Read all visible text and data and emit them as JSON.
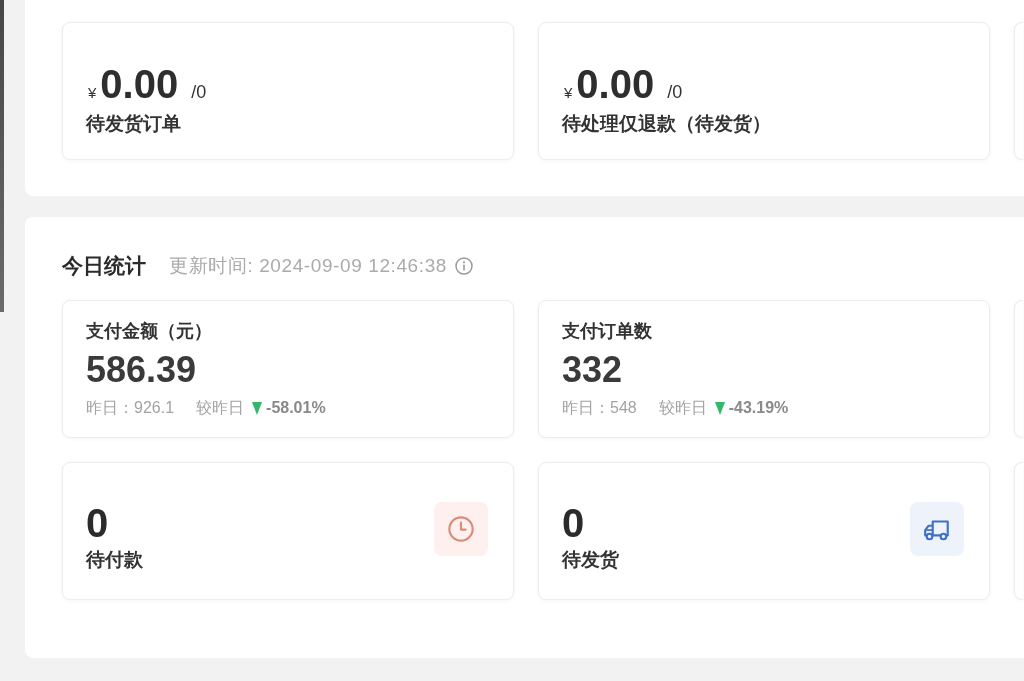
{
  "summary_cards": [
    {
      "currency": "¥",
      "amount": "0.00",
      "count": "/0",
      "label": "待发货订单"
    },
    {
      "currency": "¥",
      "amount": "0.00",
      "count": "/0",
      "label": "待处理仅退款（待发货）"
    }
  ],
  "today_stats": {
    "title": "今日统计",
    "updated": "更新时间: 2024-09-09 12:46:38",
    "metrics": [
      {
        "label": "支付金额（元）",
        "value": "586.39",
        "yesterday": "昨日：926.1",
        "compare_label": "较昨日",
        "declined": true,
        "change": "-58.01%"
      },
      {
        "label": "支付订单数",
        "value": "332",
        "yesterday": "昨日：548",
        "compare_label": "较昨日",
        "declined": true,
        "change": "-43.19%"
      }
    ],
    "counters": [
      {
        "kind": "unpaid",
        "value": "0",
        "label": "待付款"
      },
      {
        "kind": "unshipped",
        "value": "0",
        "label": "待发货"
      }
    ]
  }
}
